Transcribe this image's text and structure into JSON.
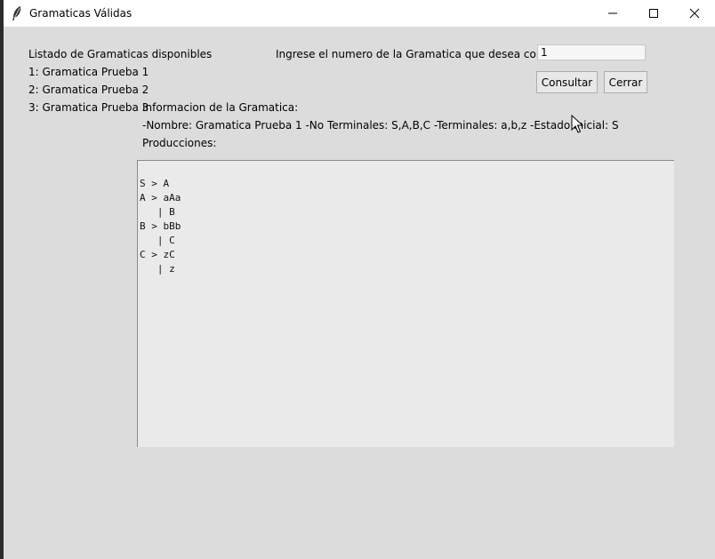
{
  "window": {
    "title": "Gramaticas Válidas"
  },
  "list": {
    "header": "Listado de Gramaticas disponibles",
    "items": [
      "1: Gramatica Prueba 1",
      "2: Gramatica Prueba 2",
      "3: Gramatica Prueba 3"
    ]
  },
  "query": {
    "prompt": "Ingrese el numero de la Gramatica que desea consultar",
    "value": "1",
    "consult_label": "Consultar",
    "close_label": "Cerrar"
  },
  "info": {
    "header": "Informacion de la Gramatica:",
    "details": "-Nombre: Gramatica Prueba 1  -No Terminales: S,A,B,C   -Terminales: a,b,z   -Estado Inicial: S",
    "productions_label": "Producciones:"
  },
  "productions": [
    "S > A",
    "A > aAa",
    "   | B",
    "B > bBb",
    "   | C",
    "C > zC",
    "   | z"
  ]
}
